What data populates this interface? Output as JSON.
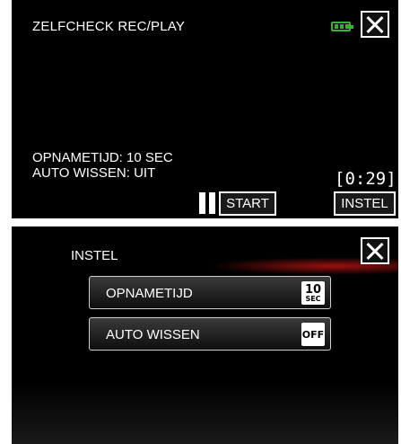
{
  "record_screen": {
    "title": "ZELFCHECK REC/PLAY",
    "record_time_text": "OPNAMETIJD: 10 SEC",
    "auto_delete_text": "AUTO WISSEN: UIT",
    "timer": "[0:29]",
    "start_label": "START",
    "settings_label": "INSTEL",
    "battery_color": "#2fb52f"
  },
  "settings_screen": {
    "title": "INSTEL",
    "items": [
      {
        "label": "OPNAMETIJD",
        "value_top": "10",
        "value_bottom": "SEC",
        "icon": "ten-seconds-icon"
      },
      {
        "label": "AUTO WISSEN",
        "value_top": "OFF",
        "value_bottom": "",
        "icon": "off-icon"
      }
    ]
  }
}
